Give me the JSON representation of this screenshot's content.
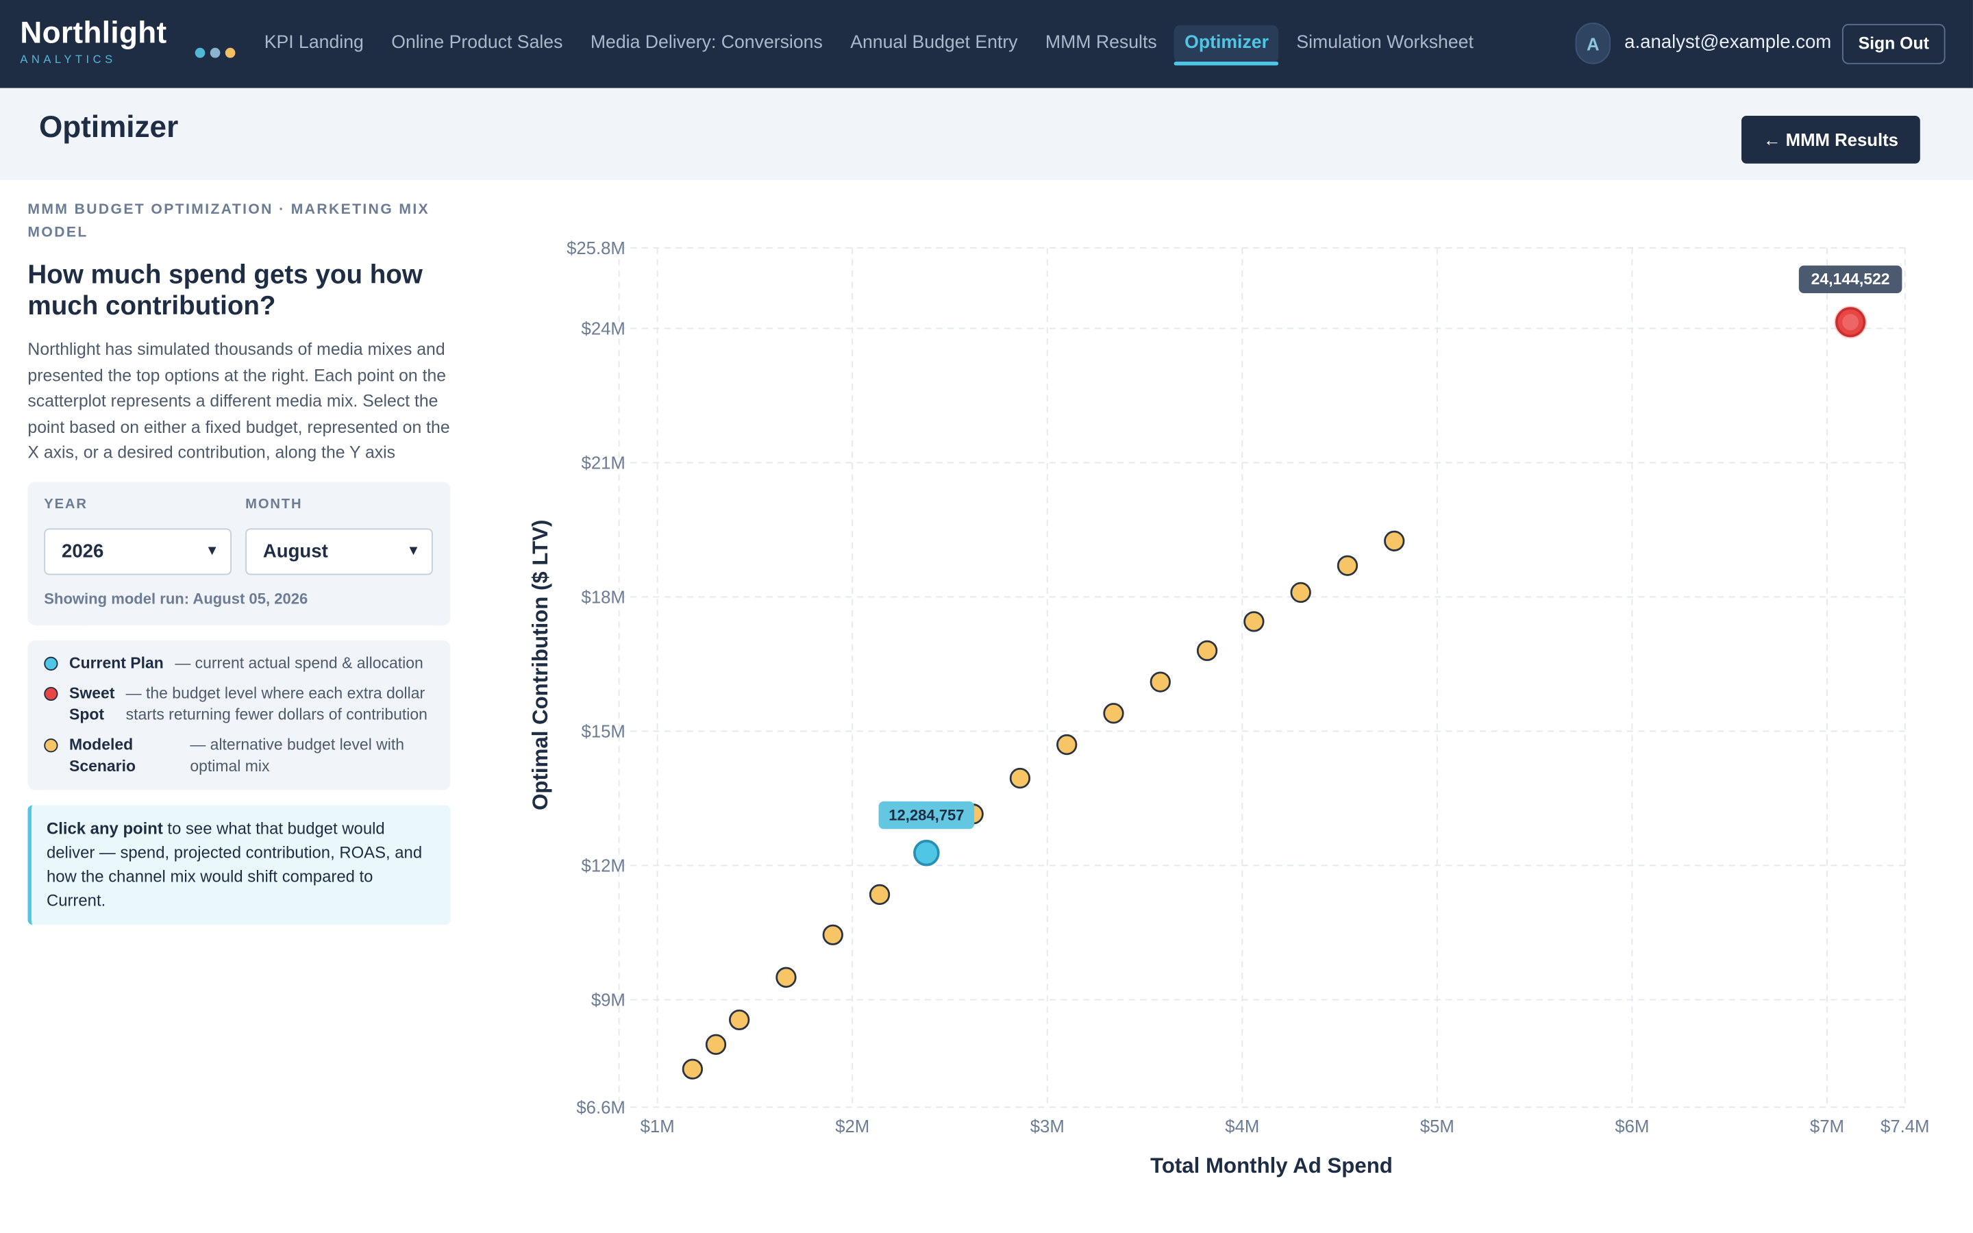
{
  "header": {
    "brand_name": "Northlight",
    "brand_sub": "ANALYTICS",
    "dot_colors": [
      "#4fb8d6",
      "#8ab4cf",
      "#f1c062"
    ],
    "nav": [
      {
        "label": "KPI Landing",
        "active": false
      },
      {
        "label": "Online Product Sales",
        "active": false
      },
      {
        "label": "Media Delivery: Conversions",
        "active": false
      },
      {
        "label": "Annual Budget Entry",
        "active": false
      },
      {
        "label": "MMM Results",
        "active": false
      },
      {
        "label": "Optimizer",
        "active": true
      },
      {
        "label": "Simulation Worksheet",
        "active": false
      }
    ],
    "avatar_initial": "A",
    "email": "a.analyst@example.com",
    "sign_out": "Sign Out"
  },
  "page": {
    "title": "Optimizer",
    "back_button": "←  MMM Results"
  },
  "sidebar": {
    "eyebrow": "MMM BUDGET OPTIMIZATION · MARKETING MIX MODEL",
    "heading": "How much spend gets you how much contribution?",
    "description": "Northlight has simulated thousands of media mixes and presented the top options at the right. Each point on the scatterplot represents a different media mix. Select the point based on either a fixed budget, represented on the X axis, or a desired contribution, along the Y axis",
    "year_label": "YEAR",
    "year_value": "2026",
    "month_label": "MONTH",
    "month_value": "August",
    "model_run": "Showing model run: August 05, 2026",
    "legend": [
      {
        "name": "Current Plan",
        "desc": "— current actual spend & allocation",
        "color": "#4fc6e6"
      },
      {
        "name": "Sweet Spot",
        "desc": "— the budget level where each extra dollar starts returning fewer dollars of contribution",
        "color": "#e84545"
      },
      {
        "name": "Modeled Scenario",
        "desc": "— alternative budget level with optimal mix",
        "color": "#f7c566"
      }
    ],
    "tip_bold": "Click any point",
    "tip_rest": " to see what that budget would deliver — spend, projected contribution, ROAS, and how the channel mix would shift compared to Current."
  },
  "chart_data": {
    "type": "scatter",
    "xlabel": "Total Monthly Ad Spend",
    "ylabel": "Optimal Contribution ($ LTV)",
    "xlim": [
      0.9,
      7.4
    ],
    "ylim": [
      6.6,
      25.8
    ],
    "x_ticks": [
      {
        "v": 1,
        "label": "$1M"
      },
      {
        "v": 2,
        "label": "$2M"
      },
      {
        "v": 3,
        "label": "$3M"
      },
      {
        "v": 4,
        "label": "$4M"
      },
      {
        "v": 5,
        "label": "$5M"
      },
      {
        "v": 6,
        "label": "$6M"
      },
      {
        "v": 7,
        "label": "$7M"
      },
      {
        "v": 7.4,
        "label": "$7.4M"
      }
    ],
    "y_ticks": [
      {
        "v": 6.6,
        "label": "$6.6M"
      },
      {
        "v": 9,
        "label": "$9M"
      },
      {
        "v": 12,
        "label": "$12M"
      },
      {
        "v": 15,
        "label": "$15M"
      },
      {
        "v": 18,
        "label": "$18M"
      },
      {
        "v": 21,
        "label": "$21M"
      },
      {
        "v": 24,
        "label": "$24M"
      },
      {
        "v": 25.8,
        "label": "$25.8M"
      }
    ],
    "grid": true,
    "series": [
      {
        "name": "Modeled Scenario",
        "color": "#f7c566",
        "points": [
          [
            1.18,
            7.45
          ],
          [
            1.3,
            8.0
          ],
          [
            1.42,
            8.55
          ],
          [
            1.66,
            9.5
          ],
          [
            1.9,
            10.45
          ],
          [
            2.14,
            11.35
          ],
          [
            2.62,
            13.15
          ],
          [
            2.86,
            13.95
          ],
          [
            3.1,
            14.7
          ],
          [
            3.34,
            15.4
          ],
          [
            3.58,
            16.1
          ],
          [
            3.82,
            16.8
          ],
          [
            4.06,
            17.45
          ],
          [
            4.3,
            18.1
          ],
          [
            4.54,
            18.7
          ],
          [
            4.78,
            19.25
          ]
        ]
      },
      {
        "name": "Current Plan",
        "color": "#4fc6e6",
        "points": [
          [
            2.38,
            12.28
          ]
        ],
        "label": "12,284,757"
      },
      {
        "name": "Sweet Spot",
        "color": "#e84545",
        "points": [
          [
            7.12,
            24.14
          ]
        ],
        "label": "24,144,522"
      }
    ]
  }
}
